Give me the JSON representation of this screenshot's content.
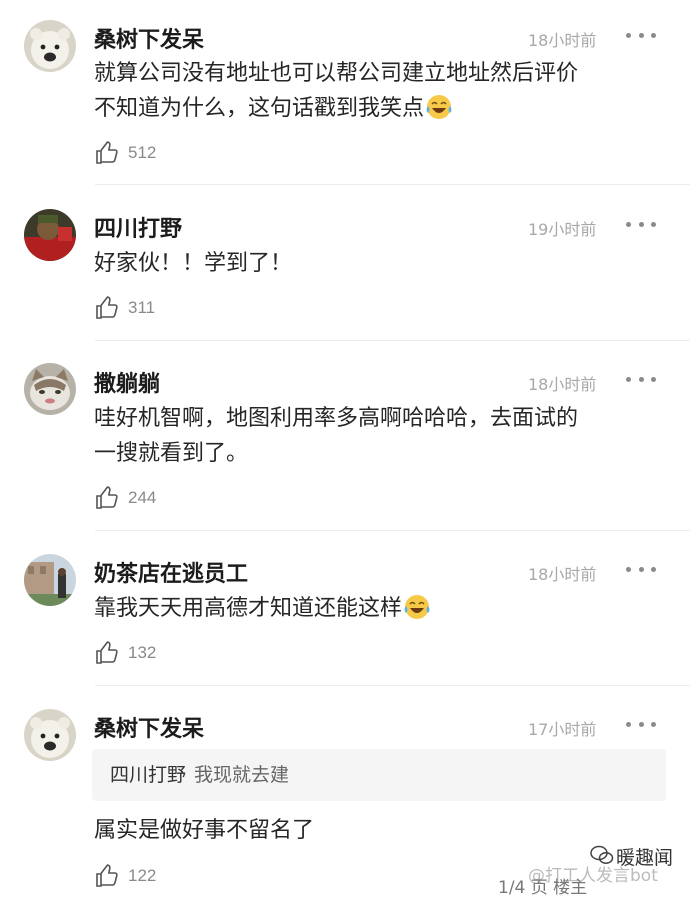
{
  "comments": [
    {
      "username": "桑树下发呆",
      "time": "18小时前",
      "lines": [
        "就算公司没有地址也可以帮公司建立地址然后评价",
        "不知道为什么，这句话戳到我笑点"
      ],
      "likes": "512"
    },
    {
      "username": "四川打野",
      "time": "19小时前",
      "lines": [
        "好家伙！！学到了！"
      ],
      "likes": "311"
    },
    {
      "username": "撒躺躺",
      "time": "18小时前",
      "lines": [
        "哇好机智啊，地图利用率多高啊哈哈哈，去面试的",
        "一搜就看到了。"
      ],
      "likes": "244"
    },
    {
      "username": "奶茶店在逃员工",
      "time": "18小时前",
      "lines": [
        "靠我天天用高德才知道还能这样"
      ],
      "likes": "132"
    },
    {
      "username": "桑树下发呆",
      "time": "17小时前",
      "quote": {
        "name": "四川打野",
        "text": "我现就去建"
      },
      "lines": [
        "属实是做好事不留名了"
      ],
      "likes": "122"
    }
  ],
  "watermark": {
    "channel": "暖趣闻",
    "handle": "@打工人发言bot",
    "partial": "1/4 页 楼主"
  },
  "icons": {
    "more": "more-dots-icon",
    "like": "thumbs-up-icon",
    "emoji": "tears-of-joy-emoji-icon"
  }
}
